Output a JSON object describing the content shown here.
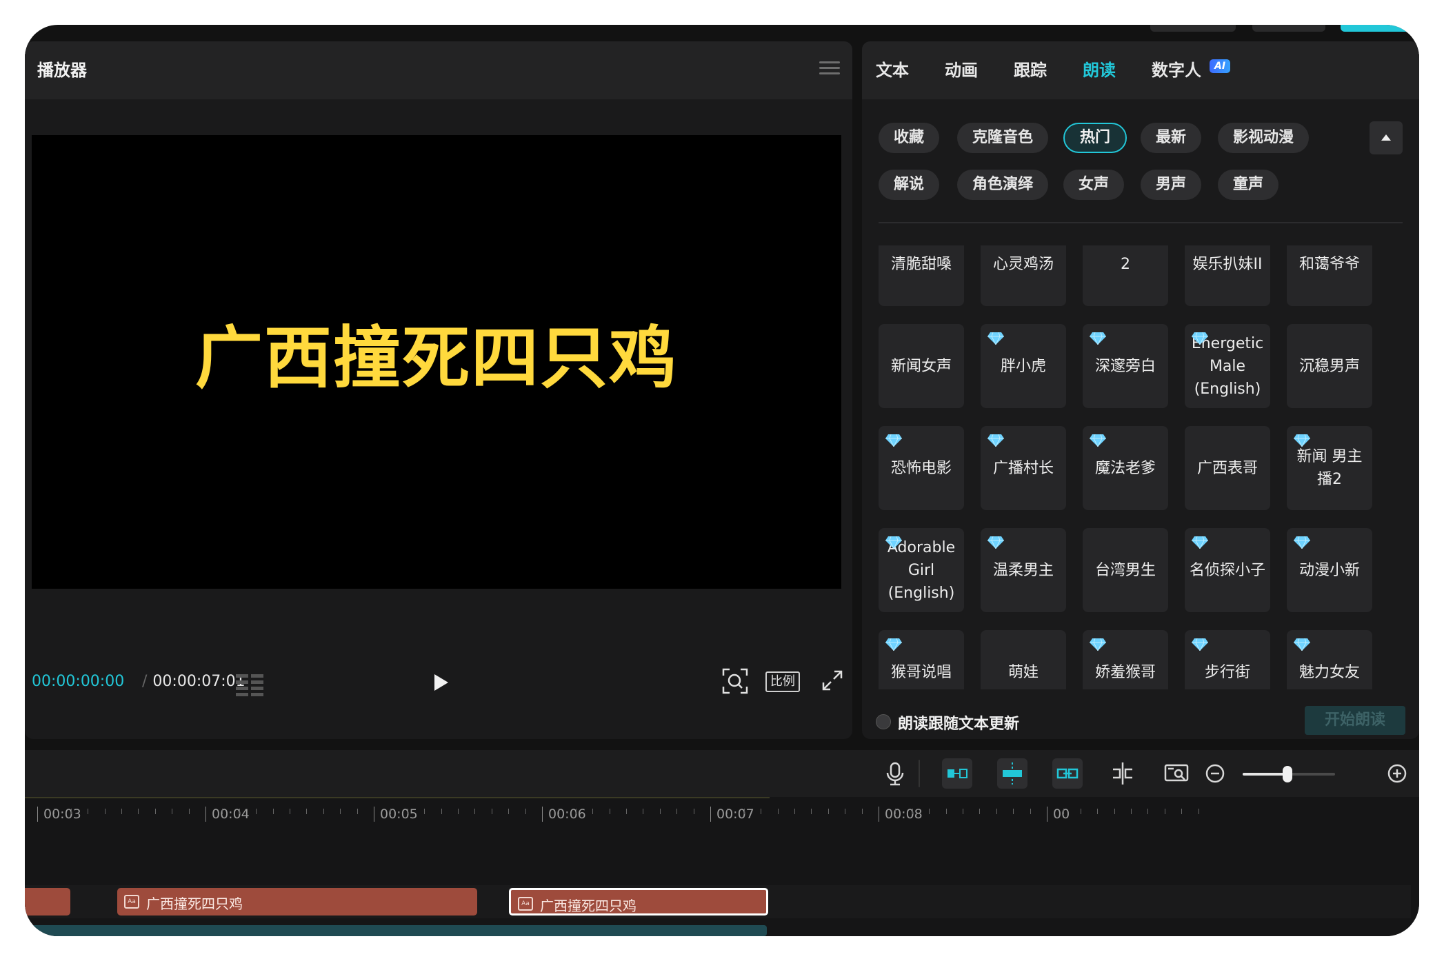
{
  "player": {
    "title": "播放器",
    "caption": "广西撞死四只鸡",
    "timecode_current": "00:00:00:00",
    "timecode_separator": "/",
    "timecode_total": "00:00:07:01",
    "ratio_label": "比例"
  },
  "side": {
    "tabs": [
      {
        "label": "文本",
        "active": false
      },
      {
        "label": "动画",
        "active": false
      },
      {
        "label": "跟踪",
        "active": false
      },
      {
        "label": "朗读",
        "active": true
      },
      {
        "label": "数字人",
        "active": false
      }
    ],
    "ai_badge": "AI",
    "chips": [
      {
        "label": "收藏",
        "selected": false
      },
      {
        "label": "克隆音色",
        "selected": false
      },
      {
        "label": "热门",
        "selected": true
      },
      {
        "label": "最新",
        "selected": false
      },
      {
        "label": "影视动漫",
        "selected": false
      },
      {
        "label": "解说",
        "selected": false
      },
      {
        "label": "角色演绎",
        "selected": false
      },
      {
        "label": "女声",
        "selected": false
      },
      {
        "label": "男声",
        "selected": false
      },
      {
        "label": "童声",
        "selected": false
      }
    ],
    "voices": [
      {
        "label": "清脆甜嗓",
        "vip": false
      },
      {
        "label": "心灵鸡汤",
        "vip": false
      },
      {
        "label": "2",
        "vip": false
      },
      {
        "label": "娱乐扒妹II",
        "vip": false
      },
      {
        "label": "和蔼爷爷",
        "vip": false
      },
      {
        "label": "新闻女声",
        "vip": false
      },
      {
        "label": "胖小虎",
        "vip": true
      },
      {
        "label": "深邃旁白",
        "vip": true
      },
      {
        "label": "Energetic Male (English)",
        "vip": true
      },
      {
        "label": "沉稳男声",
        "vip": false
      },
      {
        "label": "恐怖电影",
        "vip": true
      },
      {
        "label": "广播村长",
        "vip": true
      },
      {
        "label": "魔法老爹",
        "vip": true
      },
      {
        "label": "广西表哥",
        "vip": false
      },
      {
        "label": "新闻 男主播2",
        "vip": true
      },
      {
        "label": "Adorable Girl (English)",
        "vip": true
      },
      {
        "label": "温柔男主",
        "vip": true
      },
      {
        "label": "台湾男生",
        "vip": false
      },
      {
        "label": "名侦探小子",
        "vip": true
      },
      {
        "label": "动漫小新",
        "vip": true
      },
      {
        "label": "猴哥说唱",
        "vip": true
      },
      {
        "label": "萌娃",
        "vip": false
      },
      {
        "label": "娇羞猴哥",
        "vip": true
      },
      {
        "label": "步行街",
        "vip": true
      },
      {
        "label": "魅力女友",
        "vip": true
      }
    ],
    "follow_label": "朗读跟随文本更新",
    "start_label": "开始朗读"
  },
  "timeline": {
    "ruler_labels": [
      "00:03",
      "00:04",
      "00:05",
      "00:06",
      "00:07",
      "00:08",
      "00"
    ],
    "zoom_level": 0.5,
    "clips": [
      {
        "label": "",
        "selected": false
      },
      {
        "label": "广西撞死四只鸡",
        "selected": false
      },
      {
        "label": "广西撞死四只鸡",
        "selected": true
      }
    ]
  },
  "colors": {
    "accent": "#22c7d8",
    "caption": "#ffd93d",
    "clip": "#9e4b3c",
    "vip_gem": "#6fd3ff"
  }
}
